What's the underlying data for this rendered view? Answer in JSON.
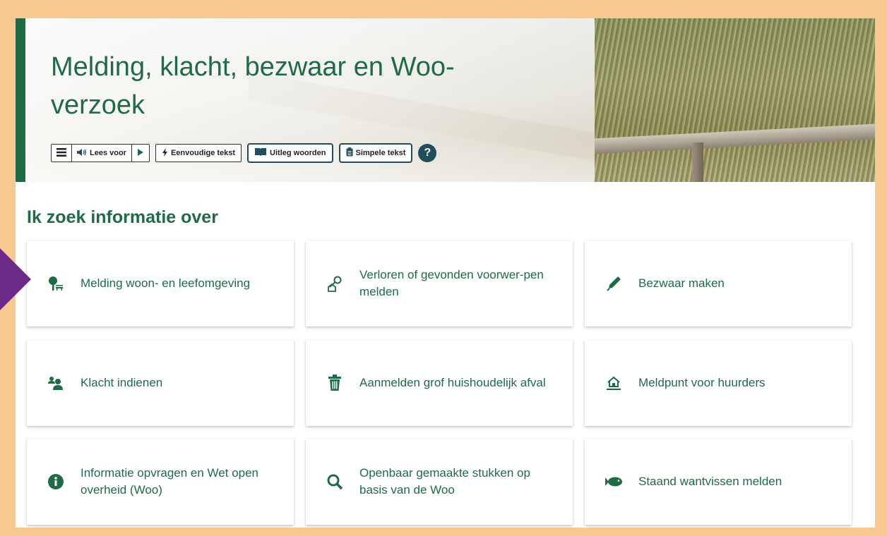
{
  "hero": {
    "title": "Melding, klacht, bezwaar en Woo-verzoek",
    "toolbar": {
      "read_aloud": "Lees voor",
      "easy_text": "Eenvoudige tekst",
      "explain_words": "Uitleg woorden",
      "simple_text": "Simpele tekst",
      "help": "?"
    }
  },
  "section": {
    "title": "Ik zoek informatie over"
  },
  "cards": [
    {
      "label": "Melding woon- en leefomgeving",
      "icon": "tree-bench-icon"
    },
    {
      "label": "Verloren of gevonden voorwer-pen melden",
      "icon": "key-house-icon"
    },
    {
      "label": "Bezwaar maken",
      "icon": "pen-icon"
    },
    {
      "label": "Klacht indienen",
      "icon": "people-icon"
    },
    {
      "label": "Aanmelden grof huishoudelijk afval",
      "icon": "trash-icon"
    },
    {
      "label": "Meldpunt voor huurders",
      "icon": "house-hand-icon"
    },
    {
      "label": "Informatie opvragen en Wet open overheid (Woo)",
      "icon": "info-icon"
    },
    {
      "label": "Openbaar gemaakte stukken op basis van de Woo",
      "icon": "search-icon"
    },
    {
      "label": "Staand wantvissen melden",
      "icon": "fish-icon"
    }
  ],
  "colors": {
    "accent": "#1f6b45",
    "frame": "#f7c98f",
    "arrow": "#6b2a86"
  }
}
